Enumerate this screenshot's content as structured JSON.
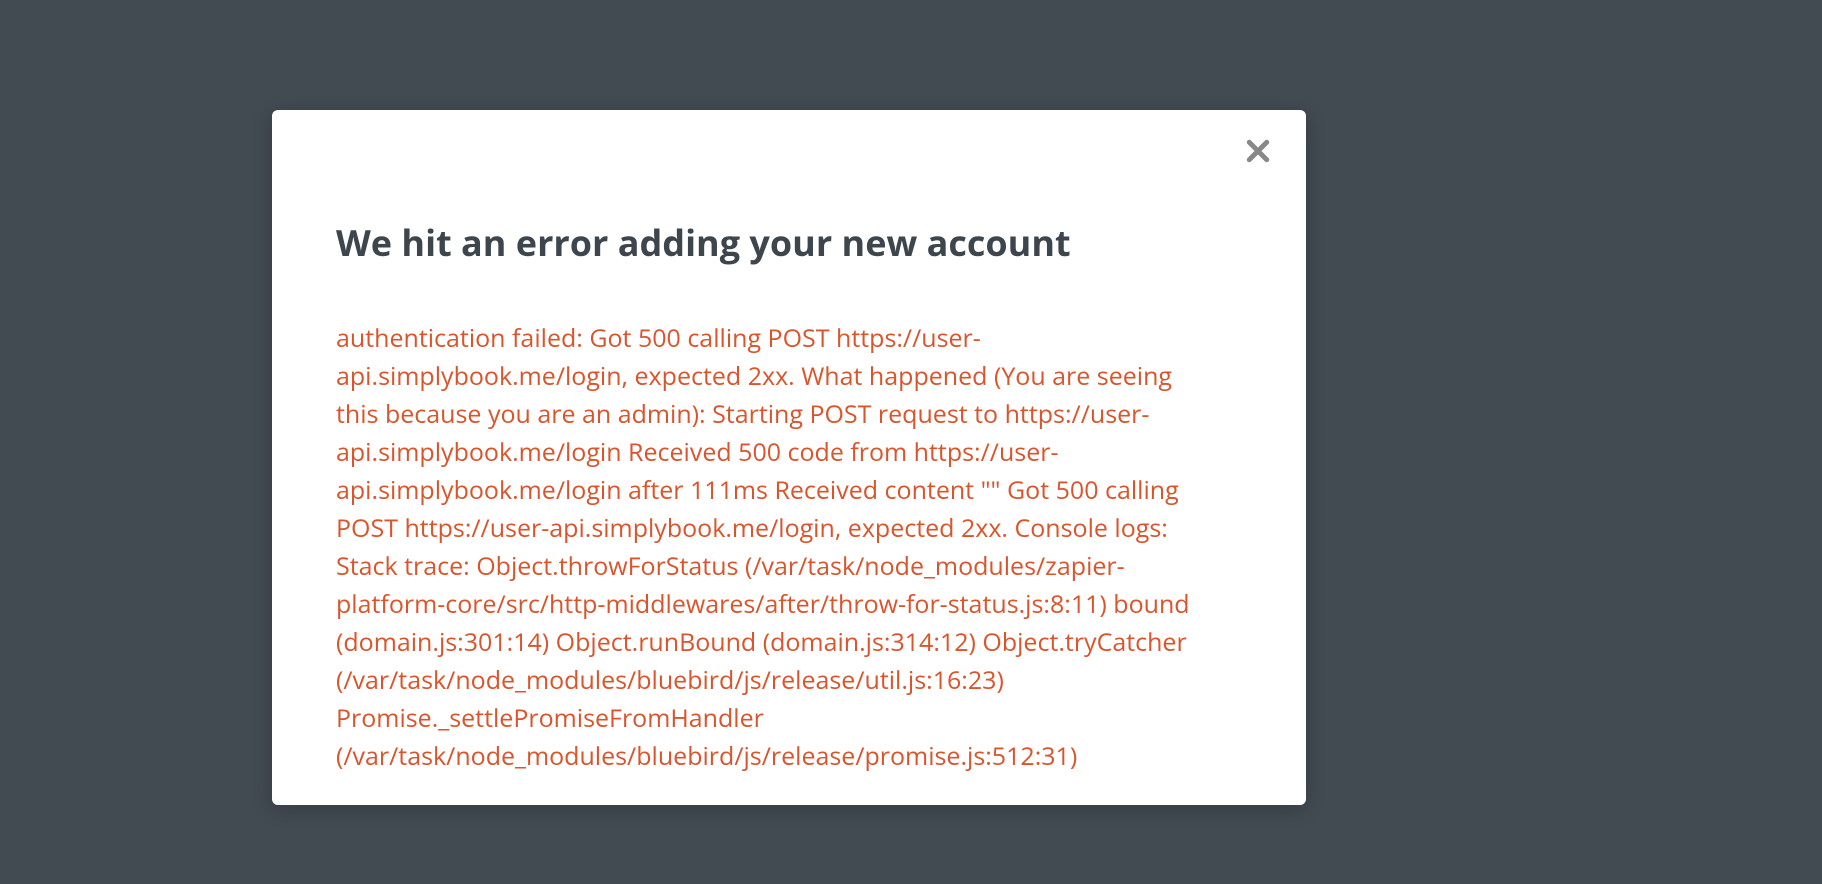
{
  "modal": {
    "title": "We hit an error adding your new account",
    "error_message": "authentication failed: Got 500 calling POST https://user-api.simplybook.me/login, expected 2xx. What happened (You are seeing this because you are an admin): Starting POST request to https://user-api.simplybook.me/login Received 500 code from https://user-api.simplybook.me/login after 111ms Received content \"\" Got 500 calling POST https://user-api.simplybook.me/login, expected 2xx. Console logs: Stack trace: Object.throwForStatus (/var/task/node_modules/zapier-platform-core/src/http-middlewares/after/throw-for-status.js:8:11) bound (domain.js:301:14) Object.runBound (domain.js:314:12) Object.tryCatcher (/var/task/node_modules/bluebird/js/release/util.js:16:23) Promise._settlePromiseFromHandler (/var/task/node_modules/bluebird/js/release/promise.js:512:31)"
  },
  "colors": {
    "background": "#424a52",
    "modal_bg": "#ffffff",
    "title_text": "#3d464d",
    "error_text": "#d9552c",
    "close_icon": "#888888"
  }
}
